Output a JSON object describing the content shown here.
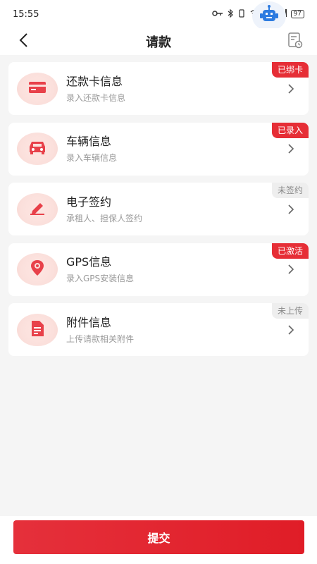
{
  "status_bar": {
    "time": "15:55",
    "network": "5G",
    "battery": "97"
  },
  "nav": {
    "title": "请款"
  },
  "items": [
    {
      "title": "还款卡信息",
      "subtitle": "录入还款卡信息",
      "badge": "已绑卡",
      "badge_style": "red",
      "icon": "bank-card-icon"
    },
    {
      "title": "车辆信息",
      "subtitle": "录入车辆信息",
      "badge": "已录入",
      "badge_style": "red",
      "icon": "car-icon"
    },
    {
      "title": "电子签约",
      "subtitle": "承租人、担保人签约",
      "badge": "未签约",
      "badge_style": "gray",
      "icon": "pen-sign-icon"
    },
    {
      "title": "GPS信息",
      "subtitle": "录入GPS安装信息",
      "badge": "已激活",
      "badge_style": "red",
      "icon": "location-pin-icon"
    },
    {
      "title": "附件信息",
      "subtitle": "上传请款相关附件",
      "badge": "未上传",
      "badge_style": "gray",
      "icon": "document-icon"
    }
  ],
  "submit": {
    "label": "提交"
  },
  "colors": {
    "accent": "#e62e36",
    "icon_bg": "#fbe0dc",
    "page_bg": "#f5f5f5"
  }
}
